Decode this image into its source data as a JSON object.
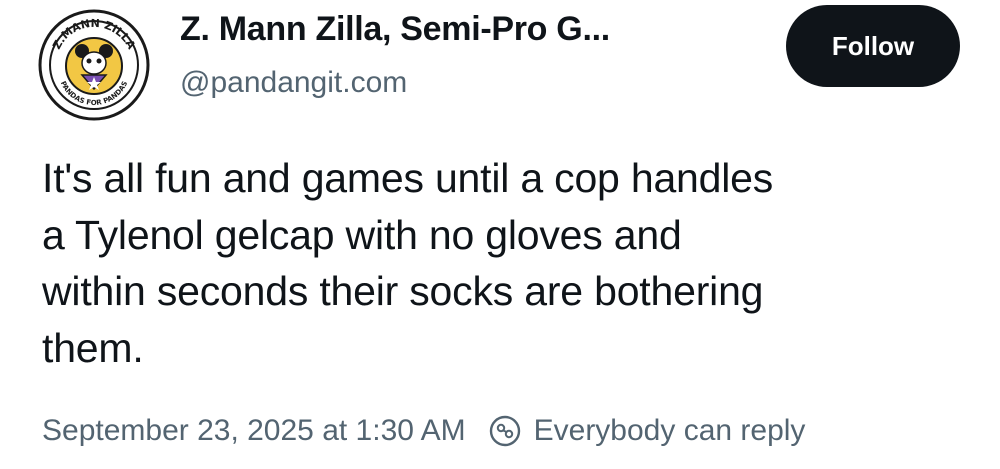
{
  "author": {
    "display_name": "Z. Mann Zilla, Semi-Pro G...",
    "handle": "@pandangit.com",
    "avatar_icon": "mascot-badge-avatar",
    "avatar_text_top": "Z.MANN ZILLA",
    "avatar_text_bottom": "PANDAS FOR PANDAS"
  },
  "follow_button": {
    "label": "Follow"
  },
  "post": {
    "lines": [
      "It's all fun and games until a cop handles",
      "a Tylenol gelcap with no gloves and",
      "within seconds their socks are bothering",
      "them."
    ]
  },
  "meta": {
    "timestamp": "September 23, 2025 at 1:30 AM",
    "reply_setting_icon": "reply-restriction-icon",
    "reply_setting": "Everybody can reply"
  },
  "colors": {
    "text_primary": "#0f1419",
    "text_secondary": "#536471",
    "button_bg": "#0f1419",
    "avatar_ring": "#1a1a1a",
    "avatar_fill": "#f2c744",
    "avatar_accent": "#7a4fb3"
  }
}
